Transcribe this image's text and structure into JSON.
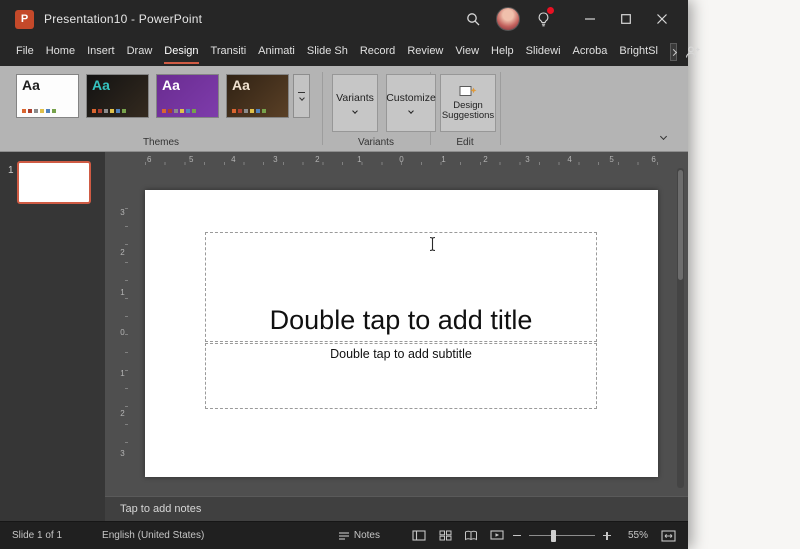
{
  "colors": {
    "accent": "#cf5b44",
    "ppt_red": "#c4492a",
    "badge": "#e81123",
    "theme2_text": "#35c3c0",
    "theme3_bg": "#6a2c91"
  },
  "window": {
    "app_icon_letter": "P",
    "title": "Presentation10 - PowerPoint"
  },
  "menubar": {
    "items": [
      "File",
      "Home",
      "Insert",
      "Draw",
      "Design",
      "Transiti",
      "Animati",
      "Slide Sh",
      "Record",
      "Review",
      "View",
      "Help",
      "Slidewi",
      "Acroba",
      "BrightSl"
    ],
    "active": "Design"
  },
  "ribbon": {
    "themes": [
      "Aa",
      "Aa",
      "Aa",
      "Aa"
    ],
    "variants_button": "Variants",
    "customize_button": "Customize",
    "design_suggestions_button": "Design Suggestions",
    "group_labels": [
      "Themes",
      "Variants",
      "Edit"
    ]
  },
  "slide_panel": {
    "slide_number": "1"
  },
  "ruler_h": [
    "6",
    "5",
    "4",
    "3",
    "2",
    "1",
    "0",
    "1",
    "2",
    "3",
    "4",
    "5",
    "6"
  ],
  "ruler_v": [
    "3",
    "2",
    "1",
    "0",
    "1",
    "2",
    "3"
  ],
  "slide": {
    "title_placeholder": "Double tap to add title",
    "subtitle_placeholder": "Double tap to add subtitle"
  },
  "notes": {
    "placeholder": "Tap to add notes"
  },
  "statusbar": {
    "slide_indicator": "Slide 1 of 1",
    "language": "English (United States)",
    "notes_label": "Notes",
    "zoom": "55%"
  }
}
